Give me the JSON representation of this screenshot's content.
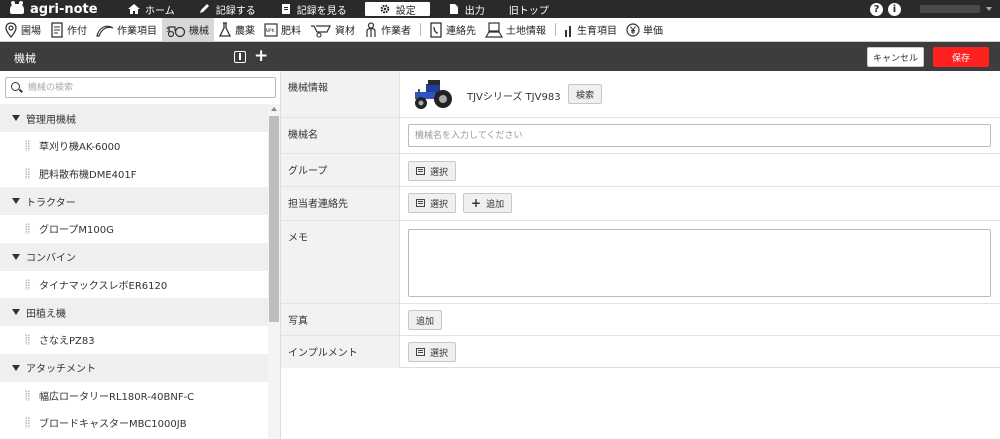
{
  "brand": {
    "name": "agri-note"
  },
  "topnav": {
    "items": [
      {
        "label": "ホーム",
        "icon": "home-icon"
      },
      {
        "label": "記録する",
        "icon": "pencil-icon"
      },
      {
        "label": "記録を見る",
        "icon": "document-icon"
      },
      {
        "label": "設定",
        "icon": "gear-icon",
        "active": true
      },
      {
        "label": "出力",
        "icon": "file-icon"
      },
      {
        "label": "旧トップ",
        "icon": ""
      }
    ],
    "help": "?",
    "info": "i"
  },
  "categories": [
    {
      "label": "圃場",
      "icon": "map-pin-icon"
    },
    {
      "label": "作付",
      "icon": "clipboard-icon"
    },
    {
      "label": "作業項目",
      "icon": "sickle-icon"
    },
    {
      "label": "機械",
      "icon": "tractor-icon",
      "active": true
    },
    {
      "label": "農薬",
      "icon": "flask-icon"
    },
    {
      "label": "肥料",
      "icon": "npk-icon"
    },
    {
      "label": "資材",
      "icon": "wheelbarrow-icon"
    },
    {
      "label": "作業者",
      "icon": "worker-icon"
    },
    {
      "label": "連絡先",
      "icon": "phone-book-icon"
    },
    {
      "label": "土地情報",
      "icon": "land-icon"
    },
    {
      "label": "生育項目",
      "icon": "growth-icon"
    },
    {
      "label": "単価",
      "icon": "yen-icon"
    }
  ],
  "header": {
    "title": "機械",
    "cancel": "キャンセル",
    "save": "保存"
  },
  "sidebar": {
    "search_placeholder": "機械の検索",
    "groups": [
      {
        "name": "管理用機械",
        "items": [
          "草刈り機AK-6000",
          "肥料散布機DME401F"
        ]
      },
      {
        "name": "トラクター",
        "items": [
          "グロープM100G"
        ]
      },
      {
        "name": "コンバイン",
        "items": [
          "タイナマックスレボER6120"
        ]
      },
      {
        "name": "田植え機",
        "items": [
          "さなえPZ83"
        ]
      },
      {
        "name": "アタッチメント",
        "items": [
          "幅広ロータリーRL180R-40BNF-C",
          "ブロードキャスターMBC1000JB"
        ]
      }
    ]
  },
  "form": {
    "info_label": "機械情報",
    "machine_name": "TJVシリーズ TJV983",
    "search_button": "検索",
    "name_label": "機械名",
    "name_placeholder": "機械名を入力してください",
    "group_label": "グループ",
    "select_button": "選択",
    "contact_label": "担当者連絡先",
    "add_button": "追加",
    "memo_label": "メモ",
    "photo_label": "写真",
    "implement_label": "インプルメント"
  },
  "colors": {
    "save": "#ff2020",
    "header_bg": "#3d3d3d",
    "topnav_bg": "#2a2a2a"
  }
}
